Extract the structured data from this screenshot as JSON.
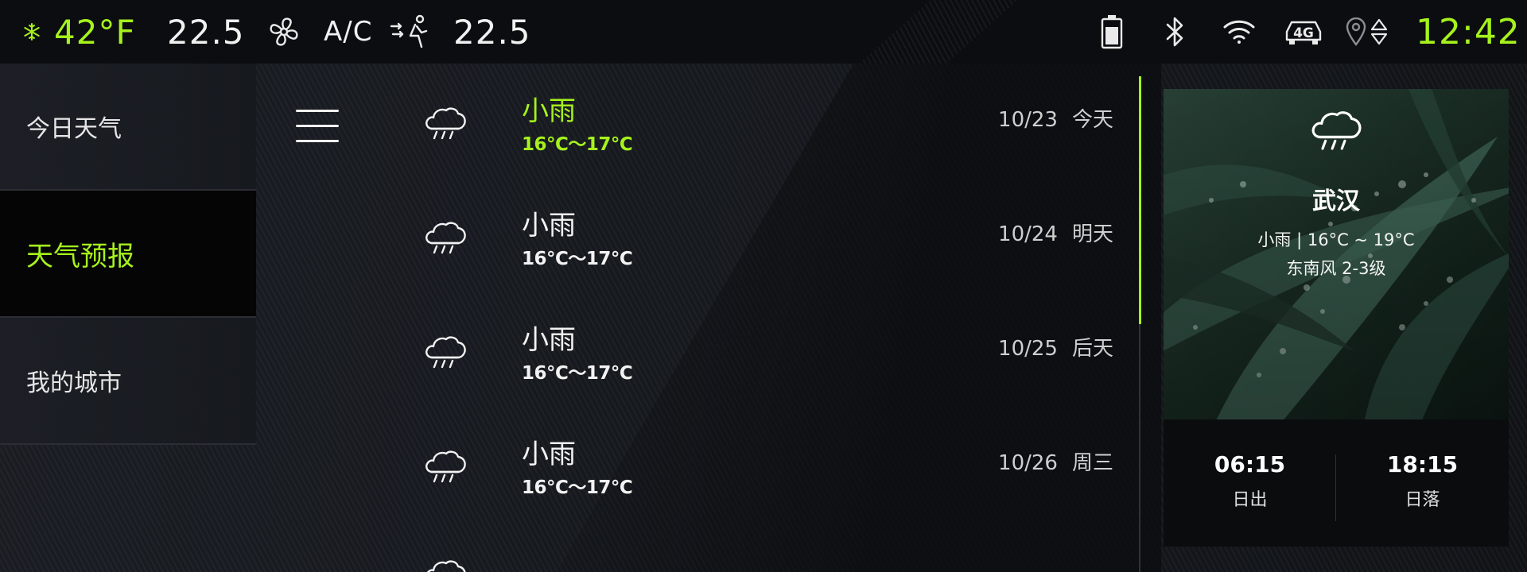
{
  "statusbar": {
    "outside_temp": "42°F",
    "left_temp": "22.5",
    "ac_label": "A/C",
    "right_temp": "22.5",
    "network": "4G",
    "time": "12:42",
    "icons": [
      "snowflake-icon",
      "fan-icon",
      "seat-airflow-icon",
      "battery-icon",
      "bluetooth-icon",
      "wifi-icon",
      "car-network-icon",
      "location-icon",
      "up-down-arrows-icon"
    ]
  },
  "sidebar": {
    "items": [
      {
        "label": "今日天气",
        "active": false
      },
      {
        "label": "天气预报",
        "active": true
      },
      {
        "label": "我的城市",
        "active": false
      }
    ]
  },
  "forecast": [
    {
      "condition": "小雨",
      "temp": "16℃～17℃",
      "date": "10/23",
      "day": "今天",
      "selected": true,
      "icon": "light-rain-icon"
    },
    {
      "condition": "小雨",
      "temp": "16℃～17℃",
      "date": "10/24",
      "day": "明天",
      "selected": false,
      "icon": "light-rain-icon"
    },
    {
      "condition": "小雨",
      "temp": "16℃～17℃",
      "date": "10/25",
      "day": "后天",
      "selected": false,
      "icon": "light-rain-icon"
    },
    {
      "condition": "小雨",
      "temp": "16℃～17℃",
      "date": "10/26",
      "day": "周三",
      "selected": false,
      "icon": "light-rain-icon"
    }
  ],
  "card": {
    "city": "武汉",
    "description": "小雨 | 16°C ~ 19°C",
    "wind": "东南风  2-3级",
    "sunrise_time": "06:15",
    "sunrise_label": "日出",
    "sunset_time": "18:15",
    "sunset_label": "日落"
  },
  "colors": {
    "accent": "#a6f21c",
    "background": "#121419",
    "statusbar": "#0c0d10"
  }
}
